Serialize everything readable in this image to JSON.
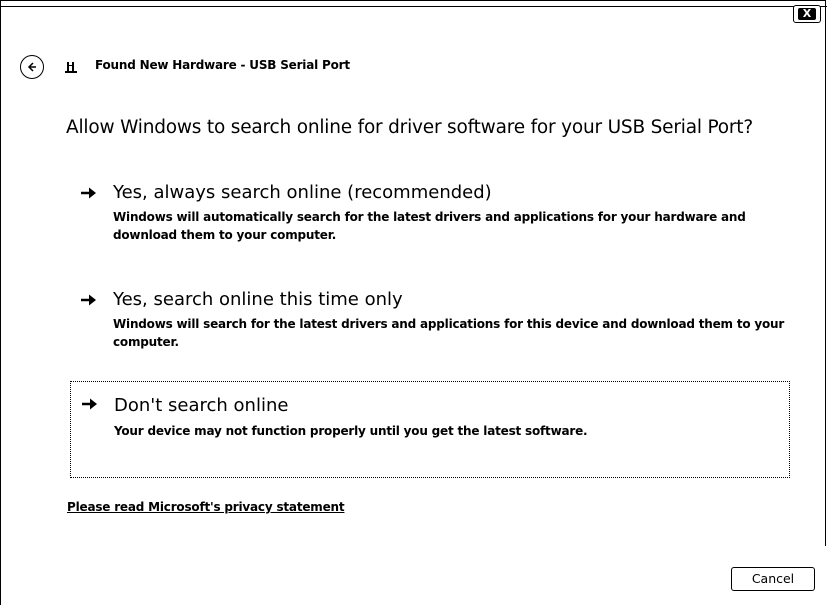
{
  "window": {
    "title": "Found New Hardware - USB Serial Port",
    "close_label": "X"
  },
  "icons": {
    "back": "back-arrow-icon",
    "hardware": "hardware-icon",
    "close": "close-icon",
    "option_arrow": "right-arrow-icon"
  },
  "main": {
    "heading": "Allow Windows to search online for driver software for your USB Serial Port?",
    "options": [
      {
        "title": "Yes, always search online (recommended)",
        "description": "Windows will automatically search for the latest drivers and applications for your hardware and download them to your computer."
      },
      {
        "title": "Yes, search online this time only",
        "description": "Windows will search for the latest drivers and applications for this device and download them to your computer."
      },
      {
        "title": "Don't search online",
        "description": "Your device may not function properly until you get the latest software."
      }
    ],
    "privacy_link": "Please read Microsoft's  privacy statement"
  },
  "footer": {
    "cancel_label": "Cancel"
  }
}
